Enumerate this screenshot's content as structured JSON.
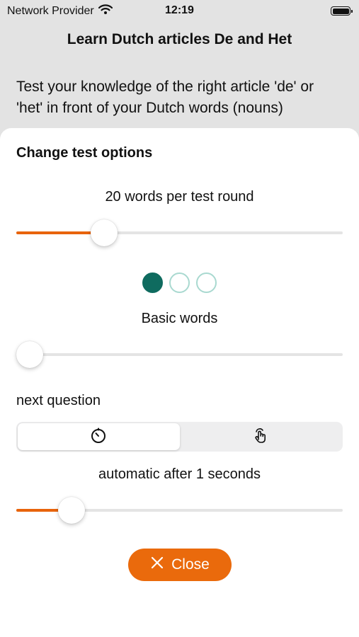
{
  "status_bar": {
    "carrier": "Network Provider",
    "time": "12:19",
    "icons": [
      "wifi-icon",
      "battery-icon"
    ]
  },
  "app": {
    "title": "Learn Dutch articles De and Het",
    "intro": "Test your knowledge of the right article 'de' or 'het' in front of your Dutch words (nouns)"
  },
  "sheet": {
    "title": "Change test options",
    "words_per_round": {
      "label": "20 words per test round",
      "slider_level": 0.27
    },
    "word_level": {
      "dots_total": 3,
      "dots_active": 1,
      "label": "Basic words",
      "slider_level": 0.0
    },
    "next_question": {
      "label": "next question",
      "options": [
        "timer-icon",
        "tap-icon"
      ],
      "selected_index": 0
    },
    "delay": {
      "label": "automatic after 1 seconds",
      "slider_level": 0.17
    },
    "close_button": {
      "label": "Close",
      "icon": "close-icon"
    }
  },
  "colors": {
    "accent": "#e8640c",
    "teal": "#0f6b5f",
    "teal_light": "#a9d9d0",
    "background": "#e3e3e3",
    "sheet": "#ffffff"
  }
}
